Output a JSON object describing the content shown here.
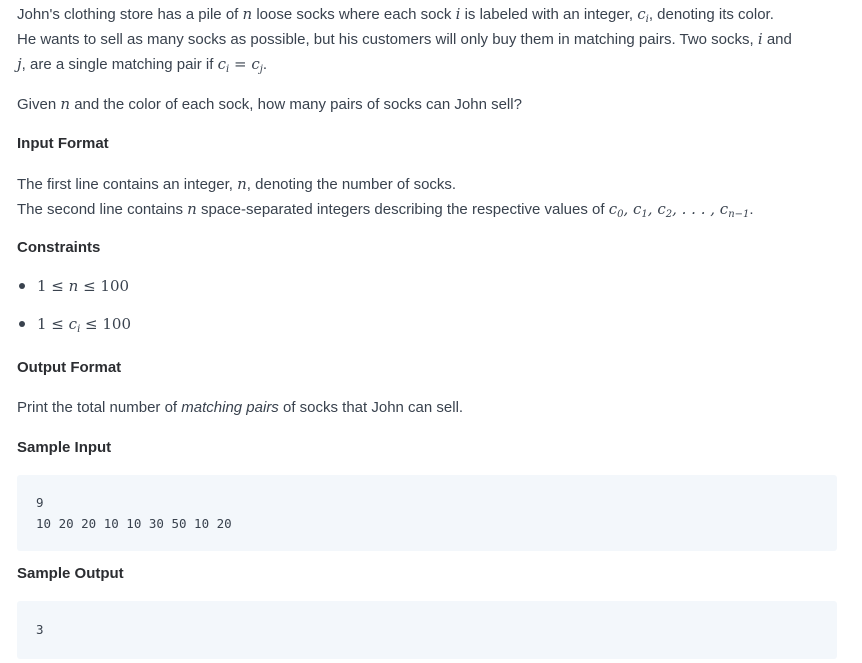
{
  "problem": {
    "intro": {
      "t1": "John's clothing store has a pile of ",
      "m1": "n",
      "t2": " loose socks where each sock ",
      "m2": "i",
      "t3": " is labeled with an integer, ",
      "m3": "c",
      "m3sub": "i",
      "t4": ", denoting its color.",
      "t5": "He wants to sell as many socks as possible, but his customers will only buy them in matching pairs. Two socks, ",
      "m4": "i",
      "t6": " and",
      "m5": "j",
      "t7": ", are a single matching pair if ",
      "m6a": "c",
      "m6asub": "i",
      "m6eq": " = ",
      "m6b": "c",
      "m6bsub": "j",
      "t8": "."
    },
    "task": {
      "t1": "Given ",
      "m1": "n",
      "t2": " and the color of each sock, how many pairs of socks can John sell?"
    }
  },
  "input_format": {
    "heading": "Input Format",
    "line1_a": "The first line contains an integer, ",
    "line1_m": "n",
    "line1_b": ", denoting the number of socks.",
    "line2_a": "The second line contains ",
    "line2_m": "n",
    "line2_b": " space-separated integers describing the respective values of ",
    "line2_math": "c0, c1, c2, . . . , cn−1",
    "line2_end": "."
  },
  "constraints": {
    "heading": "Constraints",
    "items": [
      "1 ≤ n ≤ 100",
      "1 ≤ ci ≤ 100"
    ]
  },
  "output_format": {
    "heading": "Output Format",
    "text_a": "Print the total number of ",
    "text_em": "matching pairs",
    "text_b": " of socks that John can sell."
  },
  "sample_input": {
    "heading": "Sample Input",
    "lines": [
      "9",
      "10 20 20 10 10 30 50 10 20"
    ]
  },
  "sample_output": {
    "heading": "Sample Output",
    "lines": [
      "3"
    ]
  }
}
